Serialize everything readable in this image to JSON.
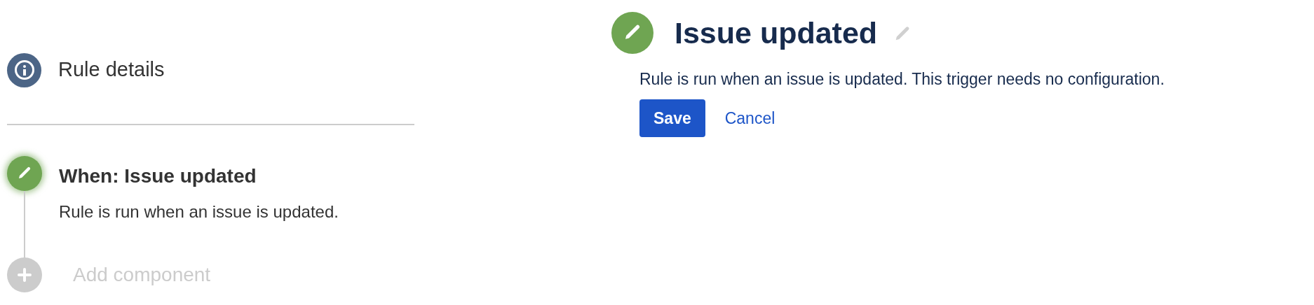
{
  "sidebar": {
    "rule_details": {
      "label": "Rule details"
    },
    "trigger": {
      "title": "When: Issue updated",
      "description": "Rule is run when an issue is updated.",
      "selected": true
    },
    "add_component": {
      "label": "Add component",
      "disabled": true
    }
  },
  "editor": {
    "title": "Issue updated",
    "description": "Rule is run when an issue is updated. This trigger needs no configuration.",
    "buttons": [
      {
        "label": "Save",
        "kind": "primary"
      },
      {
        "label": "Cancel",
        "kind": "link"
      }
    ]
  }
}
